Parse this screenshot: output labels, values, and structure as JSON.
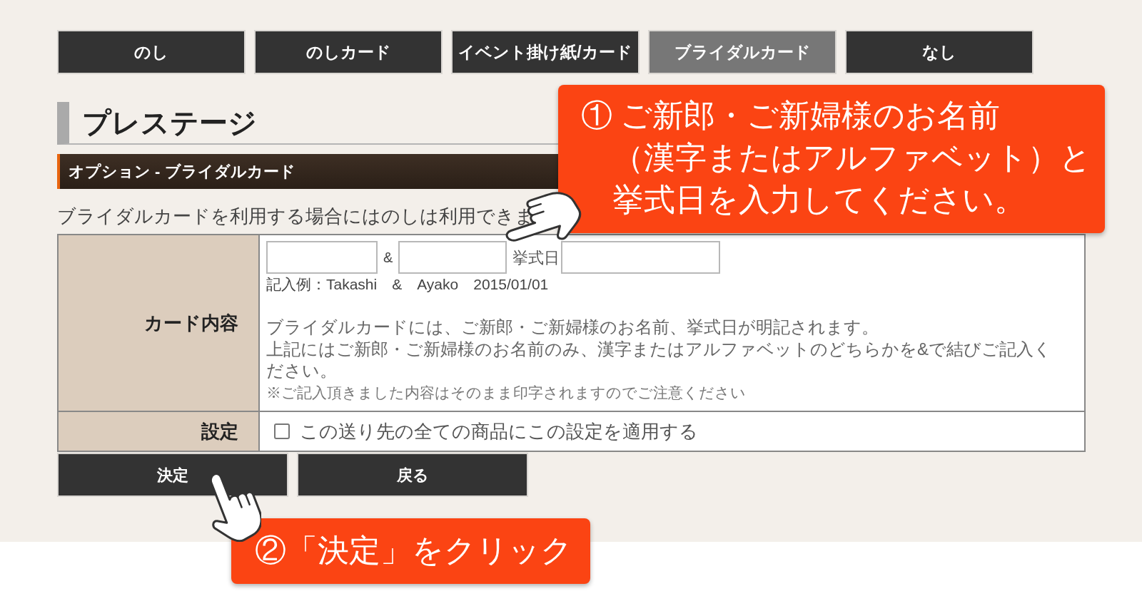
{
  "tabs": [
    {
      "label": "のし",
      "selected": false
    },
    {
      "label": "のしカード",
      "selected": false
    },
    {
      "label": "イベント掛け紙/カード",
      "selected": false
    },
    {
      "label": "ブライダルカード",
      "selected": true
    },
    {
      "label": "なし",
      "selected": false
    }
  ],
  "heading": "プレステージ",
  "section_title": "オプション - ブライダルカード",
  "intro": "ブライダルカードを利用する場合にはのしは利用できま",
  "form": {
    "card_content": {
      "label": "カード内容",
      "name_separator": "&",
      "date_label": "挙式日",
      "example": "記入例：Takashi　&　Ayako　2015/01/01",
      "notes": [
        "ブライダルカードには、ご新郎・ご新婦様のお名前、挙式日が明記されます。",
        "上記にはご新郎・ご新婦様のお名前のみ、漢字またはアルファベットのどちらかを&で結びご記入ください。"
      ],
      "caution": "※ご記入頂きました内容はそのまま印字されますのでご注意ください"
    },
    "setting": {
      "label": "設定",
      "checkbox": {
        "label": "この送り先の全ての商品にこの設定を適用する",
        "checked": false
      }
    }
  },
  "buttons": [
    "決定",
    "戻る"
  ],
  "callouts": [
    {
      "lines": [
        "① ご新郎・ご新婦様のお名前",
        "（漢字またはアルファベット）と",
        "挙式日を入力してください。"
      ]
    },
    {
      "lines": [
        "②「決定」をクリック"
      ]
    }
  ]
}
